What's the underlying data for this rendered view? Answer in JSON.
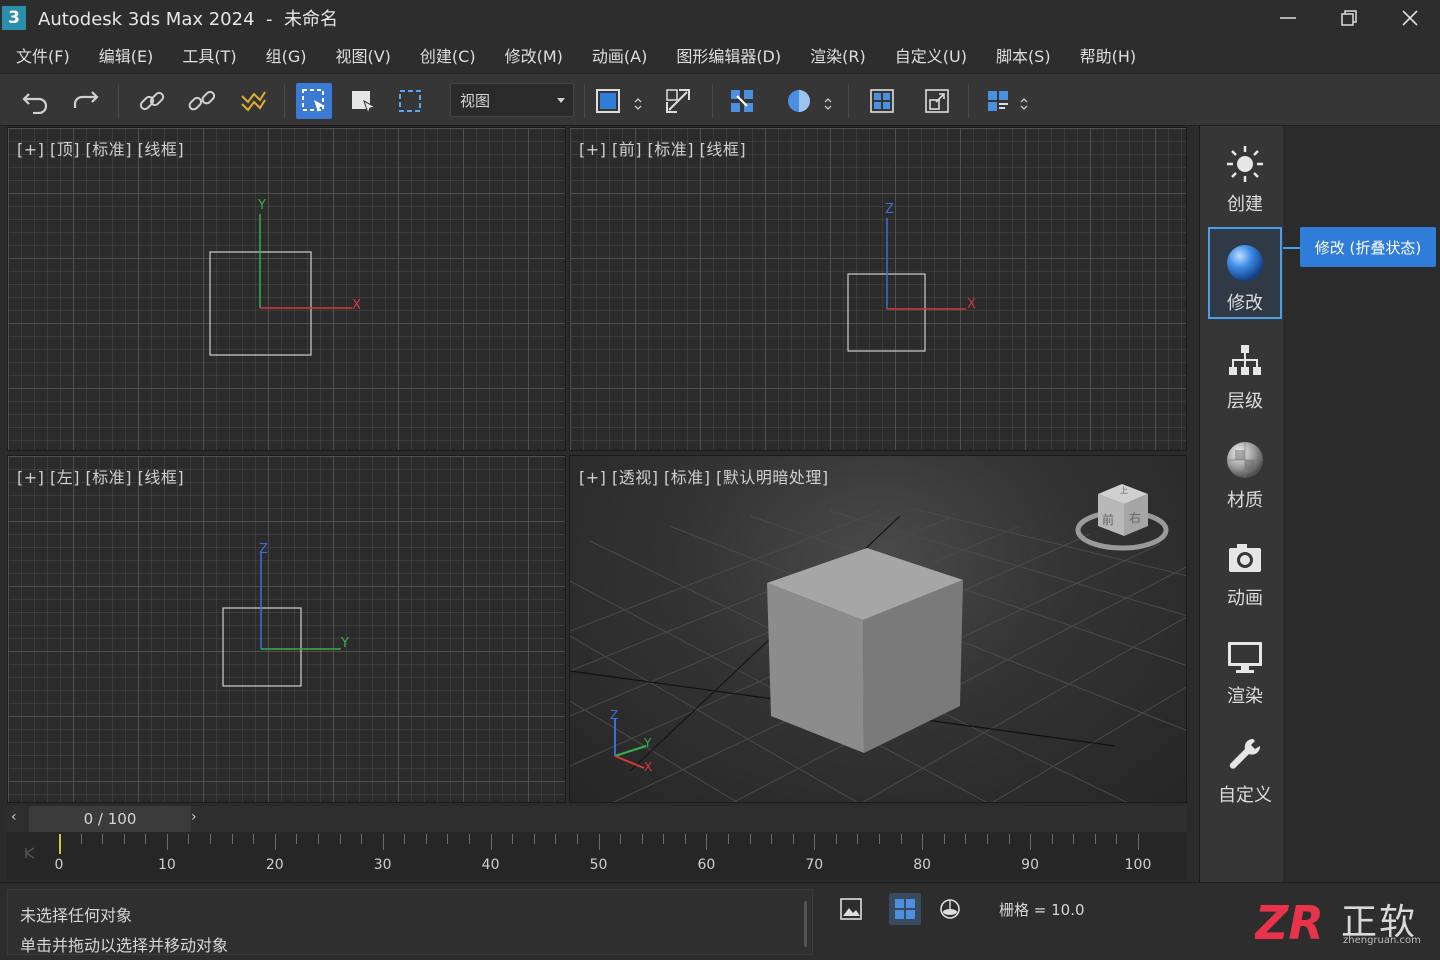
{
  "window": {
    "app_icon": "3",
    "title": "Autodesk 3ds Max 2024",
    "title_sep": "-",
    "document": "未命名"
  },
  "menu": [
    "文件(F)",
    "编辑(E)",
    "工具(T)",
    "组(G)",
    "视图(V)",
    "创建(C)",
    "修改(M)",
    "动画(A)",
    "图形编辑器(D)",
    "渲染(R)",
    "自定义(U)",
    "脚本(S)",
    "帮助(H)"
  ],
  "toolbar": {
    "reference_coord_value": "视图",
    "icons": [
      "undo-icon",
      "redo-icon",
      "link-icon",
      "unlink-icon",
      "bind-spacewarp-icon",
      "select-object-icon",
      "select-by-name-icon",
      "rect-region-icon",
      "select-move-icon",
      "scale-icon",
      "snap-icon",
      "mirror-icon",
      "align-icon",
      "layer-explorer-icon",
      "render-setup-icon",
      "scene-explorer-icon"
    ]
  },
  "viewports": {
    "top": "[+] [顶] [标准] [线框]",
    "front": "[+] [前] [标准] [线框]",
    "left": "[+] [左] [标准] [线框]",
    "perspective": "[+] [透视] [标准] [默认明暗处理]"
  },
  "axes": {
    "x": "X",
    "y": "Y",
    "z": "Z",
    "x_color": "#d23a3a",
    "y_color": "#38b04a",
    "z_color": "#3a6fd8"
  },
  "viewcube": {
    "front": "前",
    "right": "右",
    "top": "上"
  },
  "command_panel": {
    "tabs": [
      {
        "label": "创建",
        "icon": "create-sun-icon"
      },
      {
        "label": "修改",
        "icon": "modify-sphere-icon"
      },
      {
        "label": "层级",
        "icon": "hierarchy-icon"
      },
      {
        "label": "材质",
        "icon": "material-icon"
      },
      {
        "label": "动画",
        "icon": "camera-icon"
      },
      {
        "label": "渲染",
        "icon": "monitor-icon"
      },
      {
        "label": "自定义",
        "icon": "wrench-icon"
      }
    ],
    "active_tab": "修改",
    "tooltip": "修改 (折叠状态)",
    "accent": "#2f7dd8"
  },
  "timeline": {
    "current_frame": "0",
    "separator": "/",
    "end_frame": "100",
    "ruler_labels": [
      "0",
      "10",
      "20",
      "30",
      "40",
      "50",
      "60",
      "70",
      "80",
      "90",
      "100"
    ]
  },
  "status": {
    "line1": "未选择任何对象",
    "line2": "单击并拖动以选择并移动对象",
    "grid": "栅格 = 10.0"
  },
  "logo": {
    "mark": "ZR",
    "name": "正软",
    "site": "zhengruan.com",
    "mark_color": "#e8334a"
  }
}
